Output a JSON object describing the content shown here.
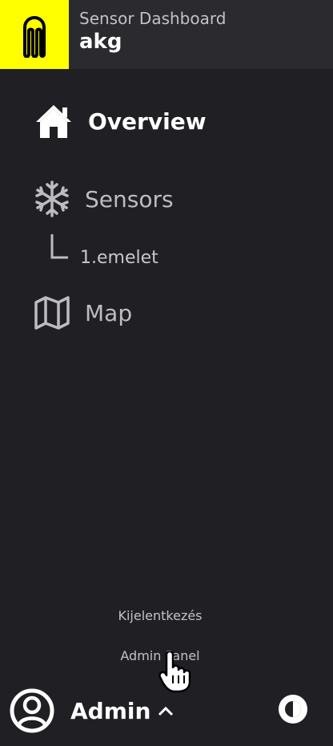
{
  "header": {
    "subtitle": "Sensor Dashboard",
    "title": "akg"
  },
  "colors": {
    "logo_bg": "#ffff00",
    "sidebar_bg": "#202024",
    "header_bg": "#2a2a2f"
  },
  "nav": {
    "overview": {
      "label": "Overview",
      "icon": "home-icon",
      "active": true
    },
    "sensors": {
      "label": "Sensors",
      "icon": "snowflake-icon"
    },
    "sensors_sub": {
      "label": "1.emelet"
    },
    "map": {
      "label": "Map",
      "icon": "map-icon"
    }
  },
  "footer": {
    "logout_label": "Kijelentkezés",
    "admin_panel_label": "Admin Panel",
    "user_name": "Admin"
  }
}
